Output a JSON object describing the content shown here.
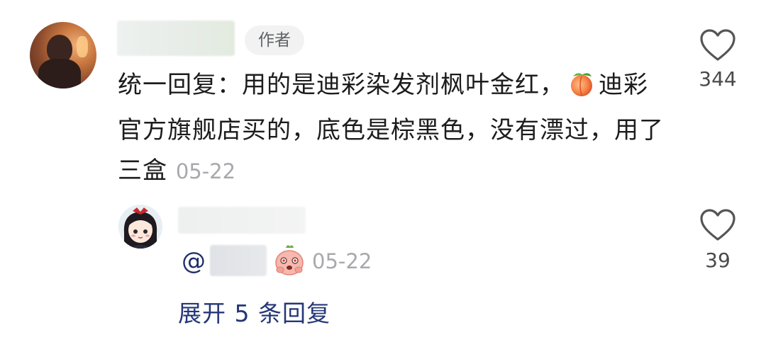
{
  "comment": {
    "author_badge": "作者",
    "text_part1": "统一回复：用的是迪彩染发剂枫叶金红，",
    "emoji": "peach-icon",
    "text_part2": "迪彩官方旗舰店买的，底色是棕黑色，没有漂过，用了三盒",
    "timestamp": "05-22",
    "like_count": "344"
  },
  "reply": {
    "mention_prefix": "@",
    "emoji": "blushing-face-icon",
    "timestamp": "05-22",
    "like_count": "39"
  },
  "expand_replies": "展开 5 条回复",
  "colors": {
    "link": "#253777",
    "timestamp": "#a8a8ad",
    "badge_bg": "#f2f2f3"
  }
}
